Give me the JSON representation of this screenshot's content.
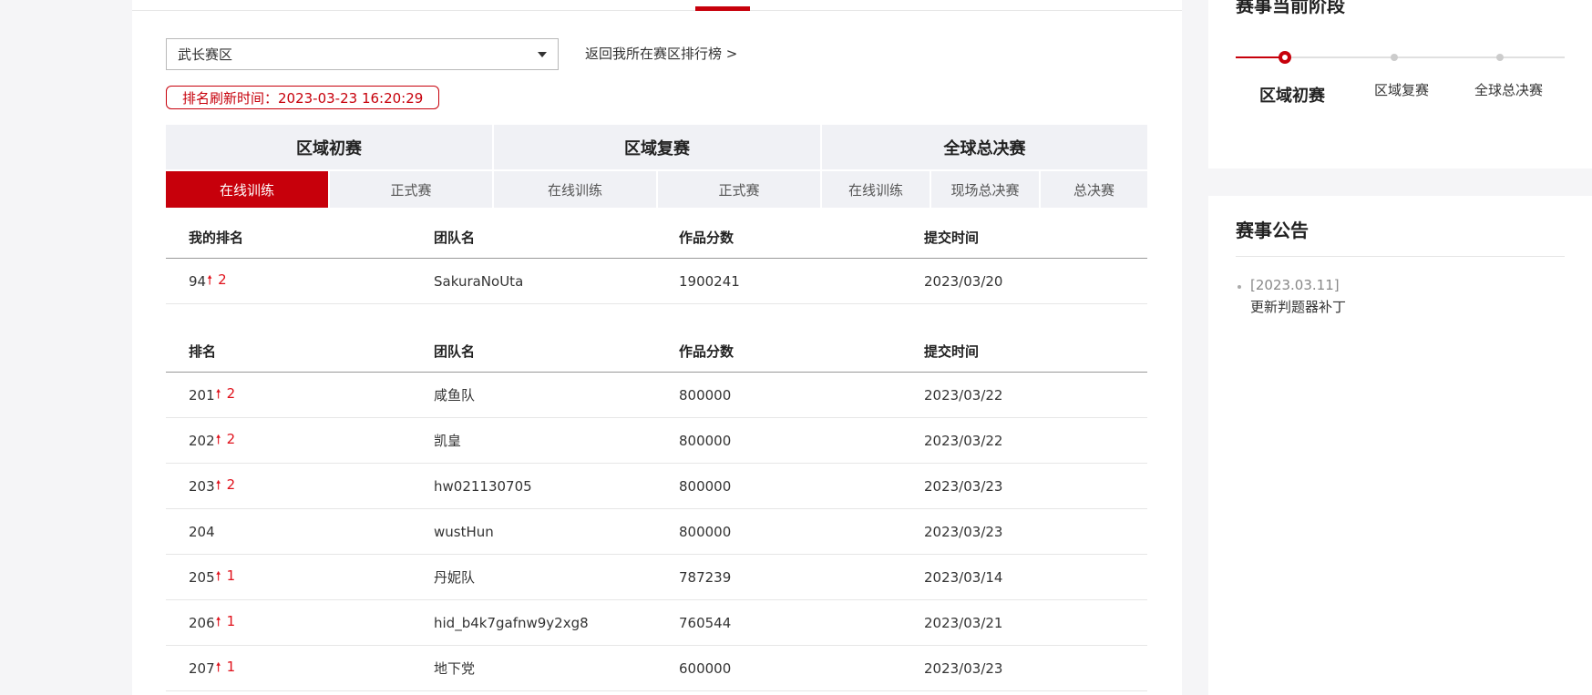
{
  "region_select": {
    "value": "武长赛区"
  },
  "back_link": "返回我所在赛区排行榜 >",
  "refresh_text": "排名刷新时间：2023-03-23 16:20:29",
  "stages": [
    {
      "label": "区域初赛"
    },
    {
      "label": "区域复赛"
    },
    {
      "label": "全球总决赛"
    }
  ],
  "sub_tabs": [
    {
      "label": "在线训练",
      "active": true
    },
    {
      "label": "正式赛"
    },
    {
      "label": "在线训练"
    },
    {
      "label": "正式赛"
    },
    {
      "label": "在线训练"
    },
    {
      "label": "现场总决赛"
    },
    {
      "label": "总决赛"
    }
  ],
  "my_rank": {
    "headers": [
      "我的排名",
      "团队名",
      "作品分数",
      "提交时间"
    ],
    "row": {
      "rank": "94",
      "change": "2",
      "team": "SakuraNoUta",
      "score": "1900241",
      "time": "2023/03/20"
    }
  },
  "ranking": {
    "headers": [
      "排名",
      "团队名",
      "作品分数",
      "提交时间"
    ],
    "rows": [
      {
        "rank": "201",
        "change": "2",
        "team": "咸鱼队",
        "score": "800000",
        "time": "2023/03/22"
      },
      {
        "rank": "202",
        "change": "2",
        "team": "凯皇",
        "score": "800000",
        "time": "2023/03/22"
      },
      {
        "rank": "203",
        "change": "2",
        "team": "hw021130705",
        "score": "800000",
        "time": "2023/03/23"
      },
      {
        "rank": "204",
        "change": "",
        "team": "wustHun",
        "score": "800000",
        "time": "2023/03/23"
      },
      {
        "rank": "205",
        "change": "1",
        "team": "丹妮队",
        "score": "787239",
        "time": "2023/03/14"
      },
      {
        "rank": "206",
        "change": "1",
        "team": "hid_b4k7gafnw9y2xg8",
        "score": "760544",
        "time": "2023/03/21"
      },
      {
        "rank": "207",
        "change": "1",
        "team": "地下党",
        "score": "600000",
        "time": "2023/03/23"
      }
    ]
  },
  "side": {
    "phase_title": "赛事当前阶段",
    "phases": [
      "区域初赛",
      "区域复赛",
      "全球总决赛"
    ],
    "notice_title": "赛事公告",
    "notices": [
      {
        "date": "[2023.03.11]",
        "text": "更新判题器补丁"
      }
    ]
  },
  "colors": {
    "accent": "#c7000b",
    "header_bg": "#f0f1f5",
    "rank_up": "#e0111b"
  }
}
